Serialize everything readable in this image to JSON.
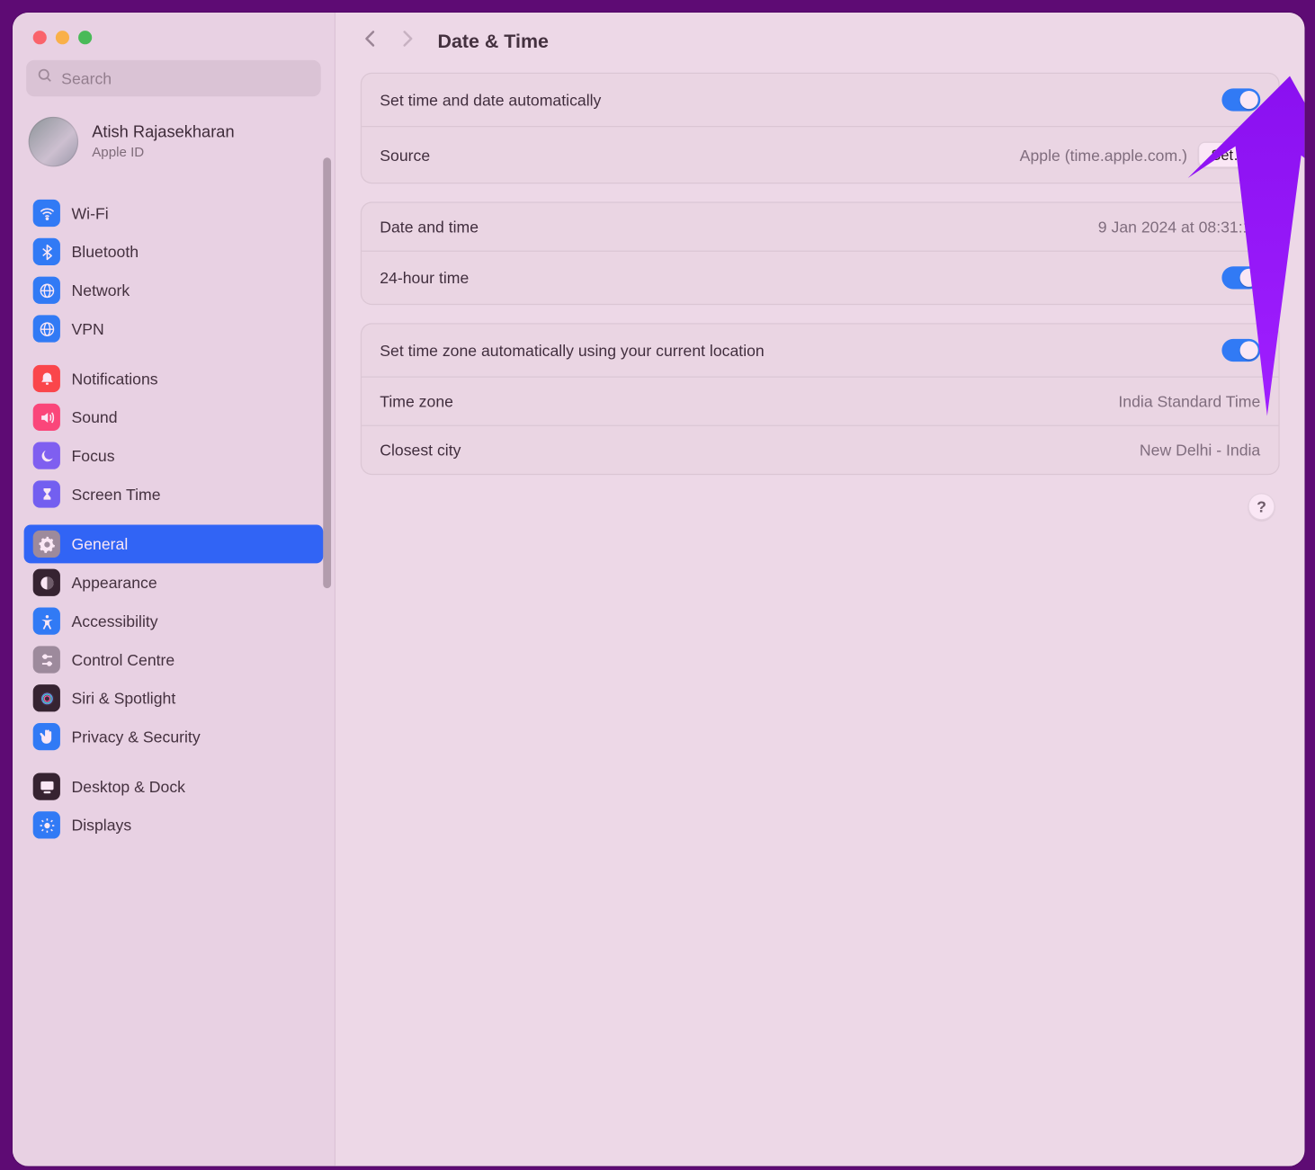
{
  "colors": {
    "accent": "#0a60ff",
    "toggle_on": "#0a7aff",
    "annotation": "#9b1fff",
    "frame": "#5e0b74"
  },
  "window": {
    "traffic_lights": [
      "red",
      "yellow",
      "green"
    ]
  },
  "search": {
    "placeholder": "Search",
    "value": ""
  },
  "account": {
    "name": "Atish Rajasekharan",
    "subtitle": "Apple ID"
  },
  "sidebar": {
    "groups": [
      {
        "items": [
          {
            "id": "wifi",
            "label": "Wi-Fi",
            "icon": "wifi-icon",
            "bg": "#0a7aff"
          },
          {
            "id": "bluetooth",
            "label": "Bluetooth",
            "icon": "bluetooth-icon",
            "bg": "#0a7aff"
          },
          {
            "id": "network",
            "label": "Network",
            "icon": "globe-icon",
            "bg": "#0a7aff"
          },
          {
            "id": "vpn",
            "label": "VPN",
            "icon": "globe-icon",
            "bg": "#0a7aff"
          }
        ]
      },
      {
        "items": [
          {
            "id": "notifications",
            "label": "Notifications",
            "icon": "bell-icon",
            "bg": "#ff3b30"
          },
          {
            "id": "sound",
            "label": "Sound",
            "icon": "speaker-icon",
            "bg": "#ff3b69"
          },
          {
            "id": "focus",
            "label": "Focus",
            "icon": "moon-icon",
            "bg": "#6a5af9"
          },
          {
            "id": "screentime",
            "label": "Screen Time",
            "icon": "hourglass-icon",
            "bg": "#5b5af9"
          }
        ]
      },
      {
        "items": [
          {
            "id": "general",
            "label": "General",
            "icon": "gear-icon",
            "bg": "#8e8e93",
            "selected": true
          },
          {
            "id": "appearance",
            "label": "Appearance",
            "icon": "appearance-icon",
            "bg": "#111111"
          },
          {
            "id": "accessibility",
            "label": "Accessibility",
            "icon": "accessibility-icon",
            "bg": "#0a7aff"
          },
          {
            "id": "controlcentre",
            "label": "Control Centre",
            "icon": "sliders-icon",
            "bg": "#8e8e93"
          },
          {
            "id": "siri",
            "label": "Siri & Spotlight",
            "icon": "siri-icon",
            "bg": "#111111"
          },
          {
            "id": "privacy",
            "label": "Privacy & Security",
            "icon": "hand-icon",
            "bg": "#0a7aff"
          }
        ]
      },
      {
        "items": [
          {
            "id": "desktopdock",
            "label": "Desktop & Dock",
            "icon": "desktop-icon",
            "bg": "#111111"
          },
          {
            "id": "displays",
            "label": "Displays",
            "icon": "sun-icon",
            "bg": "#0a7aff"
          }
        ]
      }
    ]
  },
  "header": {
    "title": "Date & Time",
    "back_enabled": true,
    "forward_enabled": false
  },
  "panels": [
    {
      "rows": [
        {
          "key": "auto_datetime",
          "label": "Set time and date automatically",
          "type": "toggle",
          "value": true
        },
        {
          "key": "source",
          "label": "Source",
          "type": "value_button",
          "value": "Apple (time.apple.com.)",
          "button": "Set…"
        }
      ]
    },
    {
      "rows": [
        {
          "key": "datetime",
          "label": "Date and time",
          "type": "value",
          "value": "9 Jan 2024 at 08:31:10"
        },
        {
          "key": "24hour",
          "label": "24-hour time",
          "type": "toggle",
          "value": true
        }
      ]
    },
    {
      "rows": [
        {
          "key": "auto_tz",
          "label": "Set time zone automatically using your current location",
          "type": "toggle",
          "value": true
        },
        {
          "key": "tz",
          "label": "Time zone",
          "type": "value",
          "value": "India Standard Time"
        },
        {
          "key": "city",
          "label": "Closest city",
          "type": "value",
          "value": "New Delhi - India"
        }
      ]
    }
  ],
  "help_button": "?"
}
